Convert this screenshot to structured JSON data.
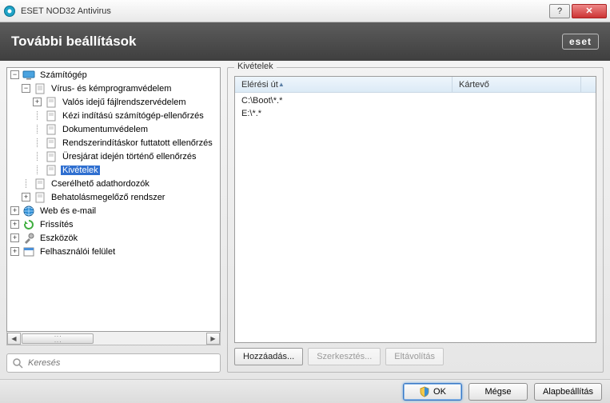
{
  "window": {
    "title": "ESET NOD32 Antivirus",
    "brand": "eset"
  },
  "header": {
    "title": "További beállítások"
  },
  "tree": {
    "nodes": {
      "computer": "Számítógép",
      "av_spy": "Vírus- és kémprogramvédelem",
      "realtime": "Valós idejű fájlrendszervédelem",
      "ondemand": "Kézi indítású számítógép-ellenőrzés",
      "docprot": "Dokumentumvédelem",
      "startup": "Rendszerindításkor futtatott ellenőrzés",
      "idle": "Üresjárat idején történő ellenőrzés",
      "exclusions": "Kivételek",
      "removable": "Cserélhető adathordozók",
      "hips": "Behatolásmegelőző rendszer",
      "web_email": "Web és e-mail",
      "update": "Frissítés",
      "tools": "Eszközök",
      "ui": "Felhasználói felület"
    }
  },
  "group": {
    "legend": "Kivételek",
    "columns": {
      "path": "Elérési út",
      "threat": "Kártevő"
    },
    "rows": [
      "C:\\Boot\\*.*",
      "E:\\*.*"
    ],
    "buttons": {
      "add": "Hozzáadás...",
      "edit": "Szerkesztés...",
      "remove": "Eltávolítás"
    }
  },
  "footer": {
    "ok": "OK",
    "cancel": "Mégse",
    "default": "Alapbeállítás"
  },
  "search": {
    "placeholder": "Keresés"
  }
}
